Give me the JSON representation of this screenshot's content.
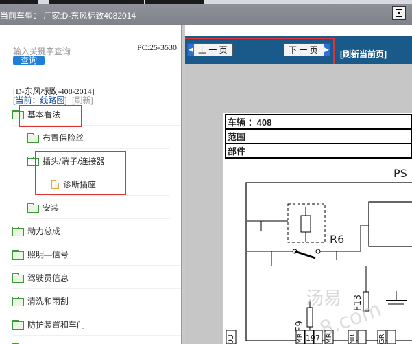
{
  "header": {
    "title": "当前车型：  厂家:D-东风标致4082014"
  },
  "search": {
    "placeholder": "输入关键字查询",
    "button_label": "查询",
    "pc_range": "PC:25-3530"
  },
  "model_line": "[D-东风标致-408-2014]",
  "current": {
    "label": "[当前：线路图]",
    "refresh": "[刷新]"
  },
  "tree": [
    {
      "label": "基本看法",
      "type": "folder",
      "level": 0
    },
    {
      "label": "布置保险丝",
      "type": "folder",
      "level": 1
    },
    {
      "label": "插头/端子/连接器",
      "type": "folder-open",
      "level": 1
    },
    {
      "label": "诊断插座",
      "type": "doc",
      "level": 2
    },
    {
      "label": "安装",
      "type": "folder",
      "level": 1
    },
    {
      "label": "动力总成",
      "type": "folder",
      "level": 0
    },
    {
      "label": "照明—信号",
      "type": "folder",
      "level": 0
    },
    {
      "label": "驾驶员信息",
      "type": "folder",
      "level": 0
    },
    {
      "label": "清洗和雨刮",
      "type": "folder",
      "level": 0
    },
    {
      "label": "防护装置和车门",
      "type": "folder",
      "level": 0
    }
  ],
  "toolbar": {
    "prev_label": "上 一 页",
    "next_label": "下 一 页",
    "refresh_label": "[刷新当前页]"
  },
  "info_table": {
    "vehicle": "车辆 ：408",
    "scope": "范围",
    "part": "部件"
  },
  "schematic": {
    "top_label": "PS",
    "relay": "R6",
    "fuse_f13": "F13",
    "fuse_f9": "F9",
    "connector_pins": [
      "03",
      "MR",
      "19",
      "MR",
      "NR",
      "GR"
    ],
    "pin_nums": [
      "19",
      "7"
    ]
  },
  "watermark": {
    "text1": "汤易",
    "text2": "8.com"
  },
  "colors": {
    "header_bg": "#86898f",
    "toolbar_bg": "#1a5a8a",
    "search_btn": "#1f7ed6",
    "highlight": "#e03333",
    "folder": "#3a9a3a"
  }
}
